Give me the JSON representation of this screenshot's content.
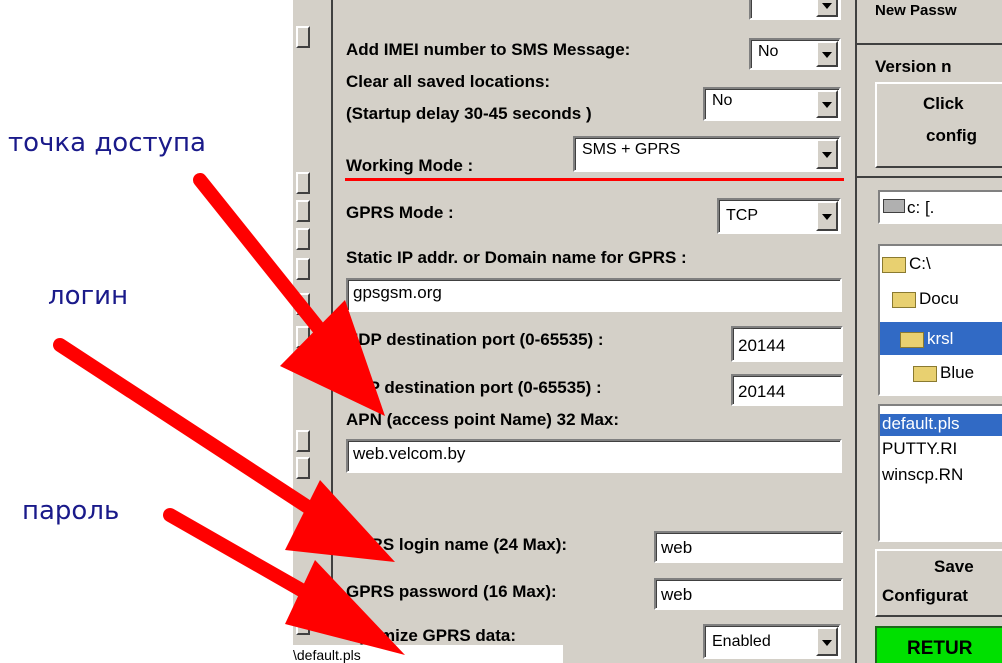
{
  "annotations": {
    "access_point": "точка доступа",
    "login": "логин",
    "password": "пароль"
  },
  "settings": {
    "imei": {
      "label": "Add IMEI number to SMS Message:",
      "value": "No"
    },
    "clear_locations": {
      "label_line1": "Clear all saved locations:",
      "label_line2": "(Startup delay 30-45 seconds )",
      "value": "No"
    },
    "working_mode": {
      "label": "Working Mode :",
      "value": "SMS + GPRS"
    },
    "gprs_mode": {
      "label": "GPRS Mode :",
      "value": "TCP"
    },
    "static_ip": {
      "label": "Static IP addr. or Domain name for GPRS :",
      "value": "gpsgsm.org"
    },
    "udp_port": {
      "label": "UDP destination port (0-65535) :",
      "value": "20144"
    },
    "tcp_port": {
      "label": "TCP destination port (0-65535) :",
      "value": "20144"
    },
    "apn": {
      "label": "APN (access point Name) 32 Max:",
      "value": "web.velcom.by"
    },
    "gprs_login": {
      "label": "GPRS login name (24 Max):",
      "value": "web"
    },
    "gprs_password": {
      "label": "GPRS password  (16 Max):",
      "value": "web"
    },
    "optimize": {
      "label": "Optimize GPRS data:",
      "value": "Enabled"
    }
  },
  "right_panel": {
    "new_password": "New Passw",
    "version": "Version n",
    "click_config_line1": "Click",
    "click_config_line2": "config",
    "drive": "c: [.",
    "folders": [
      "C:\\",
      "Docu",
      "krsl",
      "Blue"
    ],
    "files": [
      "default.pls",
      "PUTTY.RI",
      "winscp.RN"
    ],
    "save_line1": "Save",
    "save_line2": "Configurat",
    "return_label": "RETUR"
  },
  "status_path": "\\default.pls",
  "colors": {
    "annotation": "#1a1a8a",
    "arrow": "#ff0000",
    "selection": "#316ac5",
    "return_bg": "#00e000"
  }
}
